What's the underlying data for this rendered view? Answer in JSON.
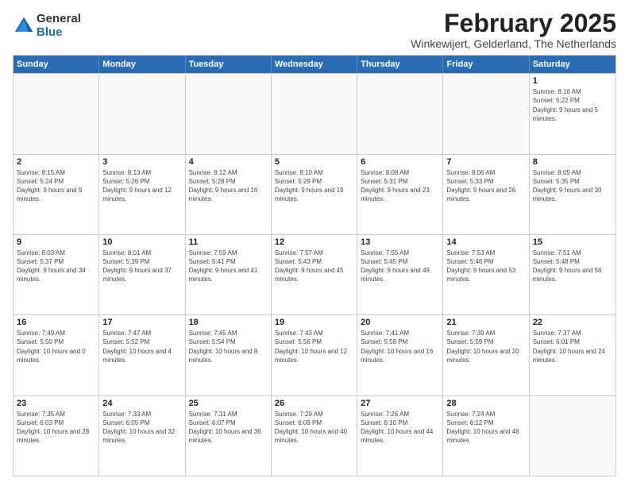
{
  "logo": {
    "general": "General",
    "blue": "Blue"
  },
  "header": {
    "month": "February 2025",
    "location": "Winkewijert, Gelderland, The Netherlands"
  },
  "days": [
    "Sunday",
    "Monday",
    "Tuesday",
    "Wednesday",
    "Thursday",
    "Friday",
    "Saturday"
  ],
  "weeks": [
    [
      {
        "day": "",
        "text": ""
      },
      {
        "day": "",
        "text": ""
      },
      {
        "day": "",
        "text": ""
      },
      {
        "day": "",
        "text": ""
      },
      {
        "day": "",
        "text": ""
      },
      {
        "day": "",
        "text": ""
      },
      {
        "day": "1",
        "text": "Sunrise: 8:16 AM\nSunset: 5:22 PM\nDaylight: 9 hours and 5 minutes."
      }
    ],
    [
      {
        "day": "2",
        "text": "Sunrise: 8:15 AM\nSunset: 5:24 PM\nDaylight: 9 hours and 9 minutes."
      },
      {
        "day": "3",
        "text": "Sunrise: 8:13 AM\nSunset: 5:26 PM\nDaylight: 9 hours and 12 minutes."
      },
      {
        "day": "4",
        "text": "Sunrise: 8:12 AM\nSunset: 5:28 PM\nDaylight: 9 hours and 16 minutes."
      },
      {
        "day": "5",
        "text": "Sunrise: 8:10 AM\nSunset: 5:29 PM\nDaylight: 9 hours and 19 minutes."
      },
      {
        "day": "6",
        "text": "Sunrise: 8:08 AM\nSunset: 5:31 PM\nDaylight: 9 hours and 23 minutes."
      },
      {
        "day": "7",
        "text": "Sunrise: 8:06 AM\nSunset: 5:33 PM\nDaylight: 9 hours and 26 minutes."
      },
      {
        "day": "8",
        "text": "Sunrise: 8:05 AM\nSunset: 5:35 PM\nDaylight: 9 hours and 30 minutes."
      }
    ],
    [
      {
        "day": "9",
        "text": "Sunrise: 8:03 AM\nSunset: 5:37 PM\nDaylight: 9 hours and 34 minutes."
      },
      {
        "day": "10",
        "text": "Sunrise: 8:01 AM\nSunset: 5:39 PM\nDaylight: 9 hours and 37 minutes."
      },
      {
        "day": "11",
        "text": "Sunrise: 7:59 AM\nSunset: 5:41 PM\nDaylight: 9 hours and 41 minutes."
      },
      {
        "day": "12",
        "text": "Sunrise: 7:57 AM\nSunset: 5:43 PM\nDaylight: 9 hours and 45 minutes."
      },
      {
        "day": "13",
        "text": "Sunrise: 7:55 AM\nSunset: 5:45 PM\nDaylight: 9 hours and 49 minutes."
      },
      {
        "day": "14",
        "text": "Sunrise: 7:53 AM\nSunset: 5:46 PM\nDaylight: 9 hours and 53 minutes."
      },
      {
        "day": "15",
        "text": "Sunrise: 7:51 AM\nSunset: 5:48 PM\nDaylight: 9 hours and 56 minutes."
      }
    ],
    [
      {
        "day": "16",
        "text": "Sunrise: 7:49 AM\nSunset: 5:50 PM\nDaylight: 10 hours and 0 minutes."
      },
      {
        "day": "17",
        "text": "Sunrise: 7:47 AM\nSunset: 5:52 PM\nDaylight: 10 hours and 4 minutes."
      },
      {
        "day": "18",
        "text": "Sunrise: 7:45 AM\nSunset: 5:54 PM\nDaylight: 10 hours and 8 minutes."
      },
      {
        "day": "19",
        "text": "Sunrise: 7:43 AM\nSunset: 5:56 PM\nDaylight: 10 hours and 12 minutes."
      },
      {
        "day": "20",
        "text": "Sunrise: 7:41 AM\nSunset: 5:58 PM\nDaylight: 10 hours and 16 minutes."
      },
      {
        "day": "21",
        "text": "Sunrise: 7:39 AM\nSunset: 5:59 PM\nDaylight: 10 hours and 20 minutes."
      },
      {
        "day": "22",
        "text": "Sunrise: 7:37 AM\nSunset: 6:01 PM\nDaylight: 10 hours and 24 minutes."
      }
    ],
    [
      {
        "day": "23",
        "text": "Sunrise: 7:35 AM\nSunset: 6:03 PM\nDaylight: 10 hours and 28 minutes."
      },
      {
        "day": "24",
        "text": "Sunrise: 7:33 AM\nSunset: 6:05 PM\nDaylight: 10 hours and 32 minutes."
      },
      {
        "day": "25",
        "text": "Sunrise: 7:31 AM\nSunset: 6:07 PM\nDaylight: 10 hours and 36 minutes."
      },
      {
        "day": "26",
        "text": "Sunrise: 7:29 AM\nSunset: 6:09 PM\nDaylight: 10 hours and 40 minutes."
      },
      {
        "day": "27",
        "text": "Sunrise: 7:26 AM\nSunset: 6:10 PM\nDaylight: 10 hours and 44 minutes."
      },
      {
        "day": "28",
        "text": "Sunrise: 7:24 AM\nSunset: 6:12 PM\nDaylight: 10 hours and 48 minutes."
      },
      {
        "day": "",
        "text": ""
      }
    ]
  ]
}
